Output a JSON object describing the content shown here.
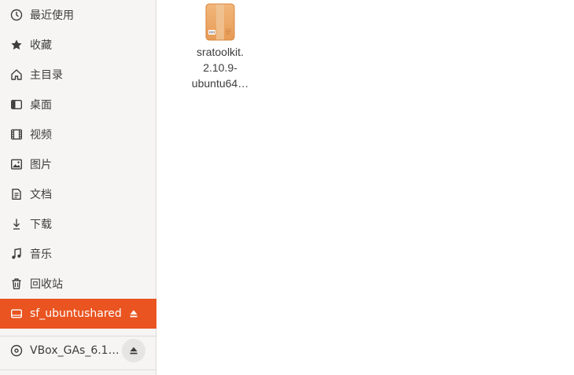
{
  "sidebar": {
    "items": [
      {
        "label": "最近使用",
        "icon": "clock-icon"
      },
      {
        "label": "收藏",
        "icon": "star-icon"
      },
      {
        "label": "主目录",
        "icon": "home-icon"
      },
      {
        "label": "桌面",
        "icon": "desktop-icon"
      },
      {
        "label": "视频",
        "icon": "film-icon"
      },
      {
        "label": "图片",
        "icon": "picture-icon"
      },
      {
        "label": "文档",
        "icon": "document-icon"
      },
      {
        "label": "下载",
        "icon": "download-icon"
      },
      {
        "label": "音乐",
        "icon": "music-icon"
      },
      {
        "label": "回收站",
        "icon": "trash-icon"
      }
    ],
    "shared": {
      "label": "sf_ubuntushared",
      "icon": "drive-icon",
      "active": true
    },
    "device": {
      "label": "VBox_GAs_6.1…",
      "icon": "disc-icon"
    },
    "accent": "#e95420"
  },
  "main": {
    "files": [
      {
        "name_line1": "sratoolkit.",
        "name_line2": "2.10.9-",
        "name_line3": "ubuntu64…",
        "icon": "archive-icon"
      }
    ]
  }
}
